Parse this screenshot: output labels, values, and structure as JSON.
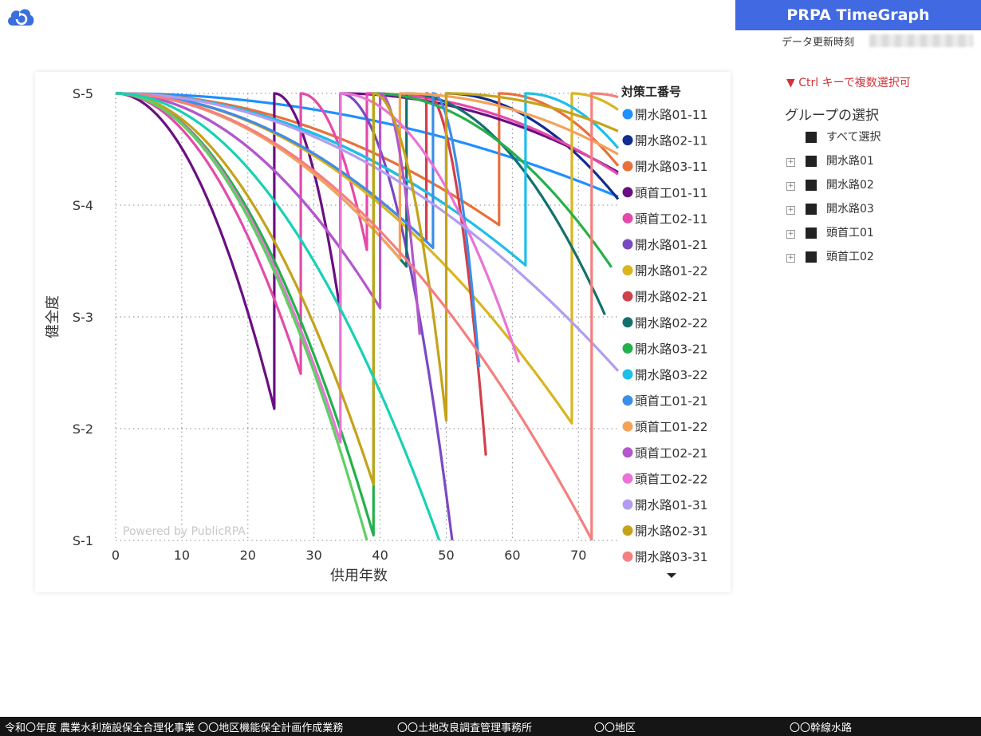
{
  "app": {
    "logo_icon": "cloud-refresh-icon",
    "title": "PRPA TimeGraph",
    "update_label": "データ更新時刻"
  },
  "chart_data": {
    "type": "line",
    "ylabel": "健全度",
    "xlabel": "供用年数",
    "x_ticks": [
      "0",
      "10",
      "20",
      "30",
      "40",
      "50",
      "60",
      "70"
    ],
    "y_ticks": [
      "S-5",
      "S-4",
      "S-3",
      "S-2",
      "S-1"
    ],
    "xlim": [
      0,
      76
    ],
    "ylim": [
      1,
      5
    ],
    "grid": true,
    "watermark": "Powered by PublicRPA",
    "legend": {
      "title": "対策工番号",
      "placement": "right",
      "more_icon": "triangle-down-icon"
    },
    "series": [
      {
        "name": "開水路01-11",
        "color": "#1e90ff",
        "segments": [
          [
            0,
            76,
            0.00016
          ]
        ]
      },
      {
        "name": "開水路02-11",
        "color": "#122c8f",
        "segments": [
          [
            0,
            50,
            0.0004
          ],
          [
            50,
            76,
            0.0014
          ]
        ]
      },
      {
        "name": "開水路03-11",
        "color": "#e8703b",
        "segments": [
          [
            0,
            58,
            0.00035
          ],
          [
            58,
            76,
            0.002
          ]
        ]
      },
      {
        "name": "頭首工01-11",
        "color": "#6a0f83",
        "segments": [
          [
            0,
            24,
            0.0049
          ],
          [
            24,
            34,
            0.0196
          ],
          [
            34,
            76,
            0.0004
          ]
        ]
      },
      {
        "name": "頭首工02-11",
        "color": "#e44aa9",
        "segments": [
          [
            0,
            28,
            0.0032
          ],
          [
            28,
            38,
            0.014
          ],
          [
            38,
            76,
            0.0005
          ]
        ]
      },
      {
        "name": "開水路01-21",
        "color": "#7a49c2",
        "segments": [
          [
            0,
            34,
            0.0012
          ],
          [
            34,
            51,
            0.014
          ]
        ]
      },
      {
        "name": "開水路01-22",
        "color": "#d9b51f",
        "segments": [
          [
            0,
            69,
            0.00062
          ],
          [
            69,
            76,
            0.003
          ]
        ]
      },
      {
        "name": "開水路02-21",
        "color": "#d1414b",
        "segments": [
          [
            0,
            47,
            0.0006
          ],
          [
            47,
            56,
            0.04
          ]
        ]
      },
      {
        "name": "開水路02-22",
        "color": "#14706d",
        "segments": [
          [
            0,
            44,
            0.0008
          ],
          [
            44,
            74,
            0.0022
          ]
        ]
      },
      {
        "name": "開水路03-21",
        "color": "#24b04a",
        "segments": [
          [
            0,
            39,
            0.0026
          ],
          [
            39,
            75,
            0.0012
          ]
        ]
      },
      {
        "name": "開水路03-22",
        "color": "#1ebfe6",
        "segments": [
          [
            0,
            62,
            0.0004
          ],
          [
            62,
            76,
            0.0025
          ]
        ]
      },
      {
        "name": "頭首工01-21",
        "color": "#3c8ee8",
        "segments": [
          [
            0,
            48,
            0.0006
          ],
          [
            48,
            55,
            0.05
          ]
        ]
      },
      {
        "name": "頭首工01-22",
        "color": "#f5a25a",
        "segments": [
          [
            0,
            43,
            0.0008
          ],
          [
            43,
            76,
            0.0005
          ]
        ]
      },
      {
        "name": "頭首工02-21",
        "color": "#b457cc",
        "segments": [
          [
            0,
            40,
            0.0012
          ],
          [
            40,
            46,
            0.06
          ]
        ]
      },
      {
        "name": "頭首工02-22",
        "color": "#ea73d5",
        "segments": [
          [
            0,
            34,
            0.0027
          ],
          [
            34,
            61,
            0.0033
          ]
        ]
      },
      {
        "name": "開水路01-31",
        "color": "#b29cf2",
        "segments": [
          [
            0,
            76,
            0.00043
          ]
        ]
      },
      {
        "name": "開水路02-31",
        "color": "#c4a31a",
        "segments": [
          [
            0,
            39,
            0.0023
          ],
          [
            39,
            50,
            0.0242
          ],
          [
            50,
            76,
            0.0005
          ]
        ]
      },
      {
        "name": "開水路03-31",
        "color": "#f47f7f",
        "segments": [
          [
            0,
            72,
            0.00077
          ],
          [
            72,
            76,
            0.002
          ]
        ]
      },
      {
        "name": "",
        "color": "#5ed062",
        "segments": [
          [
            0,
            38,
            0.00277
          ]
        ]
      },
      {
        "name": "",
        "color": "#17d1b4",
        "segments": [
          [
            0,
            49,
            0.00167
          ]
        ]
      }
    ]
  },
  "slicer": {
    "hint": "▼ Ctrl キーで複数選択可",
    "heading": "グループの選択",
    "select_all": "すべて選択",
    "groups": [
      "開水路01",
      "開水路02",
      "開水路03",
      "頭首工01",
      "頭首工02"
    ]
  },
  "footer": {
    "project": "令和〇年度 農業水利施設保全合理化事業 〇〇地区機能保全計画作成業務",
    "office": "〇〇土地改良調査管理事務所",
    "district": "〇〇地区",
    "canal": "〇〇幹線水路"
  }
}
